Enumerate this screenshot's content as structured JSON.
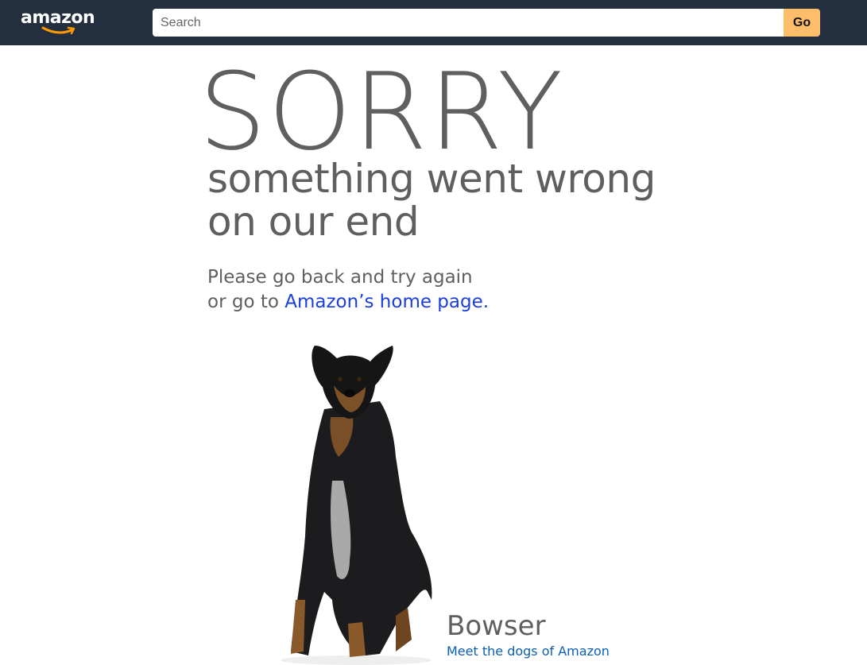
{
  "header": {
    "logo_text": "amazon",
    "search": {
      "placeholder": "Search",
      "value": ""
    },
    "go_label": "Go"
  },
  "main": {
    "headline": "SORRY",
    "subhead_line1": "something went wrong",
    "subhead_line2": "on our end",
    "message_line1": "Please go back and try again",
    "message_line2_prefix": "or go to ",
    "home_link": "Amazon’s home page."
  },
  "dog": {
    "name": "Bowser",
    "link": "Meet the dogs of Amazon"
  },
  "colors": {
    "topbar": "#232f3e",
    "go_button": "#febd69",
    "text_gray": "#5f5f5f",
    "link_blue": "#1a3fdc",
    "dog_link": "#0a5fb4"
  }
}
